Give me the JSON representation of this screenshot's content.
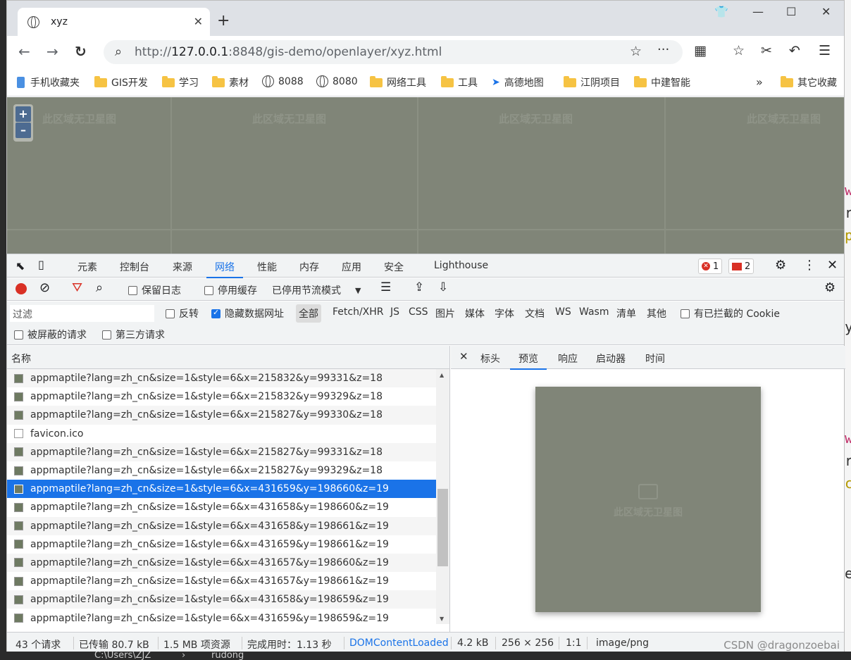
{
  "tab": {
    "title": "xyz"
  },
  "address": {
    "url_dim_prefix": "http://",
    "url_host": "127.0.0.1",
    "url_rest": ":8848/gis-demo/openlayer/xyz.html"
  },
  "bookmarks": [
    {
      "label": "手机收藏夹",
      "icon": "phone-icon"
    },
    {
      "label": "GIS开发",
      "icon": "folder-icon"
    },
    {
      "label": "学习",
      "icon": "folder-icon"
    },
    {
      "label": "素材",
      "icon": "folder-icon"
    },
    {
      "label": "8088",
      "icon": "globe-icon"
    },
    {
      "label": "8080",
      "icon": "globe-icon"
    },
    {
      "label": "网络工具",
      "icon": "folder-icon"
    },
    {
      "label": "工具",
      "icon": "folder-icon"
    },
    {
      "label": "高德地图",
      "icon": "amap-icon"
    },
    {
      "label": "江阴项目",
      "icon": "folder-icon"
    },
    {
      "label": "中建智能",
      "icon": "folder-icon"
    }
  ],
  "bookmarks_more": "»",
  "bookmarks_other": "其它收藏",
  "map": {
    "placeholder": "此区域无卫星图",
    "zoom_in": "+",
    "zoom_out": "–"
  },
  "devtools": {
    "tabs": [
      "元素",
      "控制台",
      "来源",
      "网络",
      "性能",
      "内存",
      "应用",
      "安全",
      "Lighthouse"
    ],
    "active_tab": "网络",
    "errors": "1",
    "messages": "2",
    "toolbar": {
      "preserve_log": "保留日志",
      "disable_cache": "停用缓存",
      "throttling": "已停用节流模式"
    },
    "filter": {
      "placeholder": "过滤",
      "invert": "反转",
      "hide_data_urls": "隐藏数据网址",
      "types": [
        "全部",
        "Fetch/XHR",
        "JS",
        "CSS",
        "图片",
        "媒体",
        "字体",
        "文档",
        "WS",
        "Wasm",
        "清单",
        "其他"
      ],
      "blocked_cookies": "有已拦截的 Cookie",
      "blocked_requests": "被屏蔽的请求",
      "third_party": "第三方请求"
    },
    "table": {
      "column_name": "名称",
      "rows": [
        {
          "name": "appmaptile?lang=zh_cn&size=1&style=6&x=215832&y=99331&z=18",
          "kind": "img"
        },
        {
          "name": "appmaptile?lang=zh_cn&size=1&style=6&x=215832&y=99329&z=18",
          "kind": "img"
        },
        {
          "name": "appmaptile?lang=zh_cn&size=1&style=6&x=215827&y=99330&z=18",
          "kind": "img"
        },
        {
          "name": "favicon.ico",
          "kind": "doc"
        },
        {
          "name": "appmaptile?lang=zh_cn&size=1&style=6&x=215827&y=99331&z=18",
          "kind": "img"
        },
        {
          "name": "appmaptile?lang=zh_cn&size=1&style=6&x=215827&y=99329&z=18",
          "kind": "img"
        },
        {
          "name": "appmaptile?lang=zh_cn&size=1&style=6&x=431659&y=198660&z=19",
          "kind": "img",
          "selected": true
        },
        {
          "name": "appmaptile?lang=zh_cn&size=1&style=6&x=431658&y=198660&z=19",
          "kind": "img"
        },
        {
          "name": "appmaptile?lang=zh_cn&size=1&style=6&x=431658&y=198661&z=19",
          "kind": "img"
        },
        {
          "name": "appmaptile?lang=zh_cn&size=1&style=6&x=431659&y=198661&z=19",
          "kind": "img"
        },
        {
          "name": "appmaptile?lang=zh_cn&size=1&style=6&x=431657&y=198660&z=19",
          "kind": "img"
        },
        {
          "name": "appmaptile?lang=zh_cn&size=1&style=6&x=431657&y=198661&z=19",
          "kind": "img"
        },
        {
          "name": "appmaptile?lang=zh_cn&size=1&style=6&x=431658&y=198659&z=19",
          "kind": "img"
        },
        {
          "name": "appmaptile?lang=zh_cn&size=1&style=6&x=431659&y=198659&z=19",
          "kind": "img"
        }
      ]
    },
    "detail_tabs": [
      "标头",
      "预览",
      "响应",
      "启动器",
      "时间"
    ],
    "detail_active": "预览",
    "preview_caption": "此区域无卫星图",
    "status": {
      "requests": "43 个请求",
      "transferred": "已传输 80.7 kB",
      "resources": "1.5 MB 项资源",
      "finish": "完成用时：1.13 秒",
      "dcl": "DOMContentLoaded",
      "size": "4.2 kB",
      "dims": "256 × 256",
      "ratio": "1:1",
      "mime": "image/png"
    }
  },
  "watermark": "CSDN @dragonzoebai",
  "taskbar": {
    "path": "C:\\Users\\ZJZ",
    "folder": "rudong"
  },
  "colors": {
    "map_bg": "#808578",
    "accent": "#1a73e8",
    "error": "#d93025"
  }
}
